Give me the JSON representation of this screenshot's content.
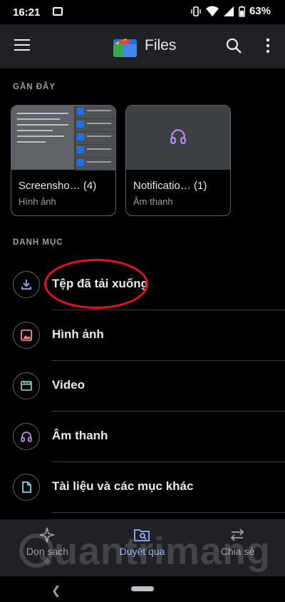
{
  "status": {
    "time": "16:21",
    "battery": "63%"
  },
  "app_bar": {
    "title": "Files",
    "icons": [
      "menu-icon",
      "files-logo",
      "search-icon",
      "more-vert-icon"
    ]
  },
  "recent": {
    "section_label": "GẦN ĐÂY",
    "cards": [
      {
        "title": "Screensho… (4)",
        "subtitle": "Hình ảnh",
        "thumb": "screenshot-thumbnail"
      },
      {
        "title": "Notificatio… (1)",
        "subtitle": "Âm thanh",
        "thumb": "headphones-icon"
      }
    ]
  },
  "categories": {
    "section_label": "DANH MỤC",
    "items": [
      {
        "label": "Tệp đã tải xuống",
        "icon": "download-icon",
        "color": "#8ab4f8"
      },
      {
        "label": "Hình ảnh",
        "icon": "image-icon",
        "color": "#f28b82"
      },
      {
        "label": "Video",
        "icon": "video-icon",
        "color": "#81c995"
      },
      {
        "label": "Âm thanh",
        "icon": "headphones-icon",
        "color": "#c58af9"
      },
      {
        "label": "Tài liệu và các mục khác",
        "icon": "document-icon",
        "color": "#78d9ec"
      }
    ]
  },
  "bottom_nav": {
    "items": [
      {
        "label": "Dọn sạch",
        "icon": "sparkle-icon",
        "active": false
      },
      {
        "label": "Duyệt qua",
        "icon": "browse-icon",
        "active": true
      },
      {
        "label": "Chia sẻ",
        "icon": "swap-icon",
        "active": false
      }
    ]
  },
  "watermark": "uantrimang",
  "colors": {
    "background": "#000000",
    "app_bar": "#202124",
    "accent": "#8ab4f8",
    "highlight": "#e0141c"
  }
}
